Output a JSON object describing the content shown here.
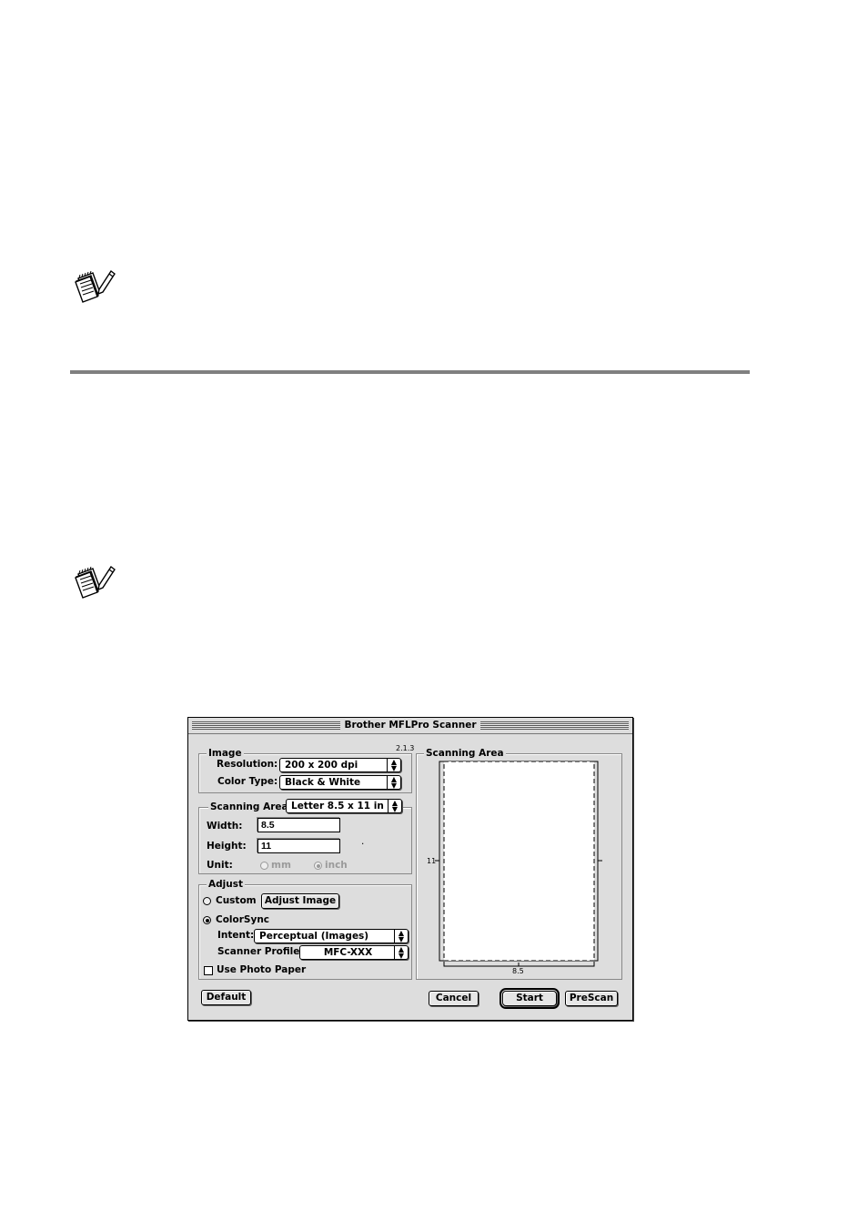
{
  "page": {
    "note_icon_1": "note-pad-pencil-icon",
    "note_icon_2": "note-pad-pencil-icon"
  },
  "dialog": {
    "title": "Brother MFLPro Scanner",
    "version": "2.1.3",
    "image_group": {
      "label": "Image",
      "resolution_label": "Resolution:",
      "resolution_value": "200 x 200 dpi",
      "color_type_label": "Color Type:",
      "color_type_value": "Black & White"
    },
    "scanning_area_group": {
      "label": "Scanning Area",
      "size_value": "Letter 8.5 x 11 in",
      "width_label": "Width:",
      "width_value": "8.5",
      "height_label": "Height:",
      "height_value": "11",
      "unit_label": "Unit:",
      "unit_options": [
        "mm",
        "inch"
      ],
      "unit_selected": "inch"
    },
    "adjust_group": {
      "label": "Adjust",
      "custom_label": "Custom",
      "custom_selected": false,
      "adjust_image_button": "Adjust Image",
      "colorsync_label": "ColorSync",
      "colorsync_selected": true,
      "intent_label": "Intent:",
      "intent_value": "Perceptual (Images)",
      "scanner_profile_label": "Scanner Profile:",
      "scanner_profile_value": "MFC-XXX",
      "use_photo_paper_label": "Use Photo Paper",
      "use_photo_paper_checked": false
    },
    "preview_group": {
      "label": "Scanning Area",
      "height_tick": "11",
      "width_tick": "8.5"
    },
    "buttons": {
      "default": "Default",
      "cancel": "Cancel",
      "start": "Start",
      "prescan": "PreScan"
    }
  }
}
